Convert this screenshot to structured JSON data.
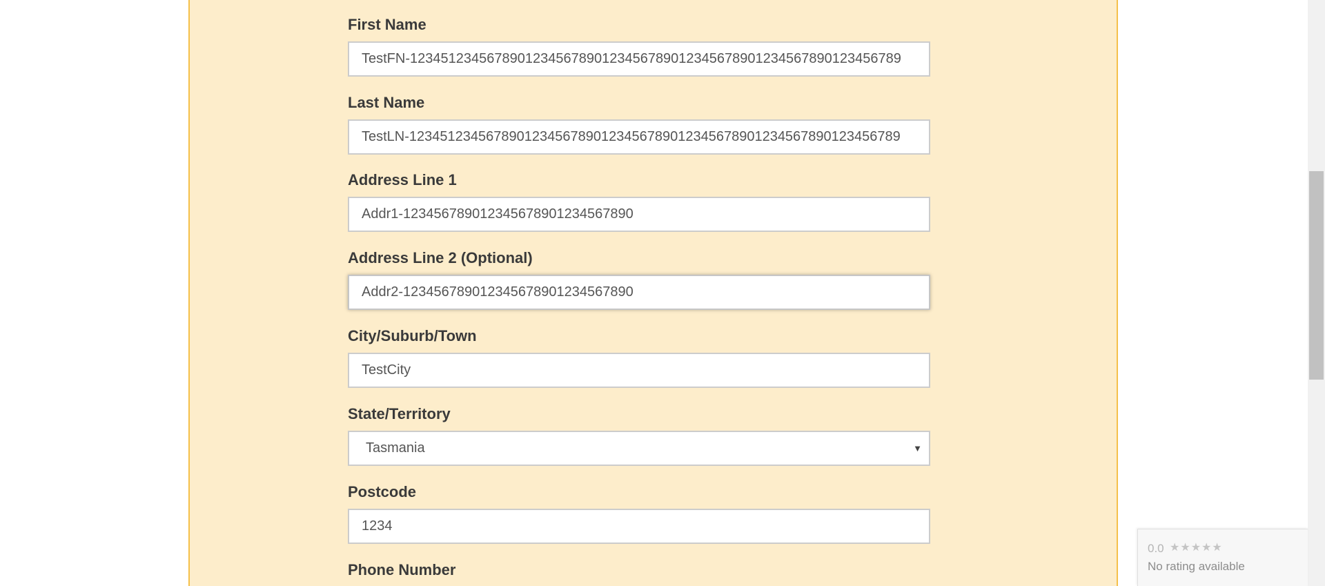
{
  "form": {
    "first_name": {
      "label": "First Name",
      "value": "TestFN-1234512345678901234567890123456789012345678901234567890123456789"
    },
    "last_name": {
      "label": "Last Name",
      "value": "TestLN-1234512345678901234567890123456789012345678901234567890123456789"
    },
    "address_line_1": {
      "label": "Address Line 1",
      "value": "Addr1-123456789012345678901234567890"
    },
    "address_line_2": {
      "label": "Address Line 2 (Optional)",
      "value": "Addr2-123456789012345678901234567890"
    },
    "city": {
      "label": "City/Suburb/Town",
      "value": "TestCity"
    },
    "state": {
      "label": "State/Territory",
      "selected": "Tasmania"
    },
    "postcode": {
      "label": "Postcode",
      "value": "1234"
    },
    "phone": {
      "label": "Phone Number"
    }
  },
  "rating_widget": {
    "score": "0.0",
    "stars": "★★★★★",
    "text": "No rating available"
  },
  "colors": {
    "panel_background": "#fdedcb",
    "panel_border": "#f5c04a",
    "label_text": "#3a3a3a",
    "input_text": "#555555"
  },
  "icons": {
    "select_arrow": "chevron-down-icon",
    "rating": "star-icon"
  }
}
